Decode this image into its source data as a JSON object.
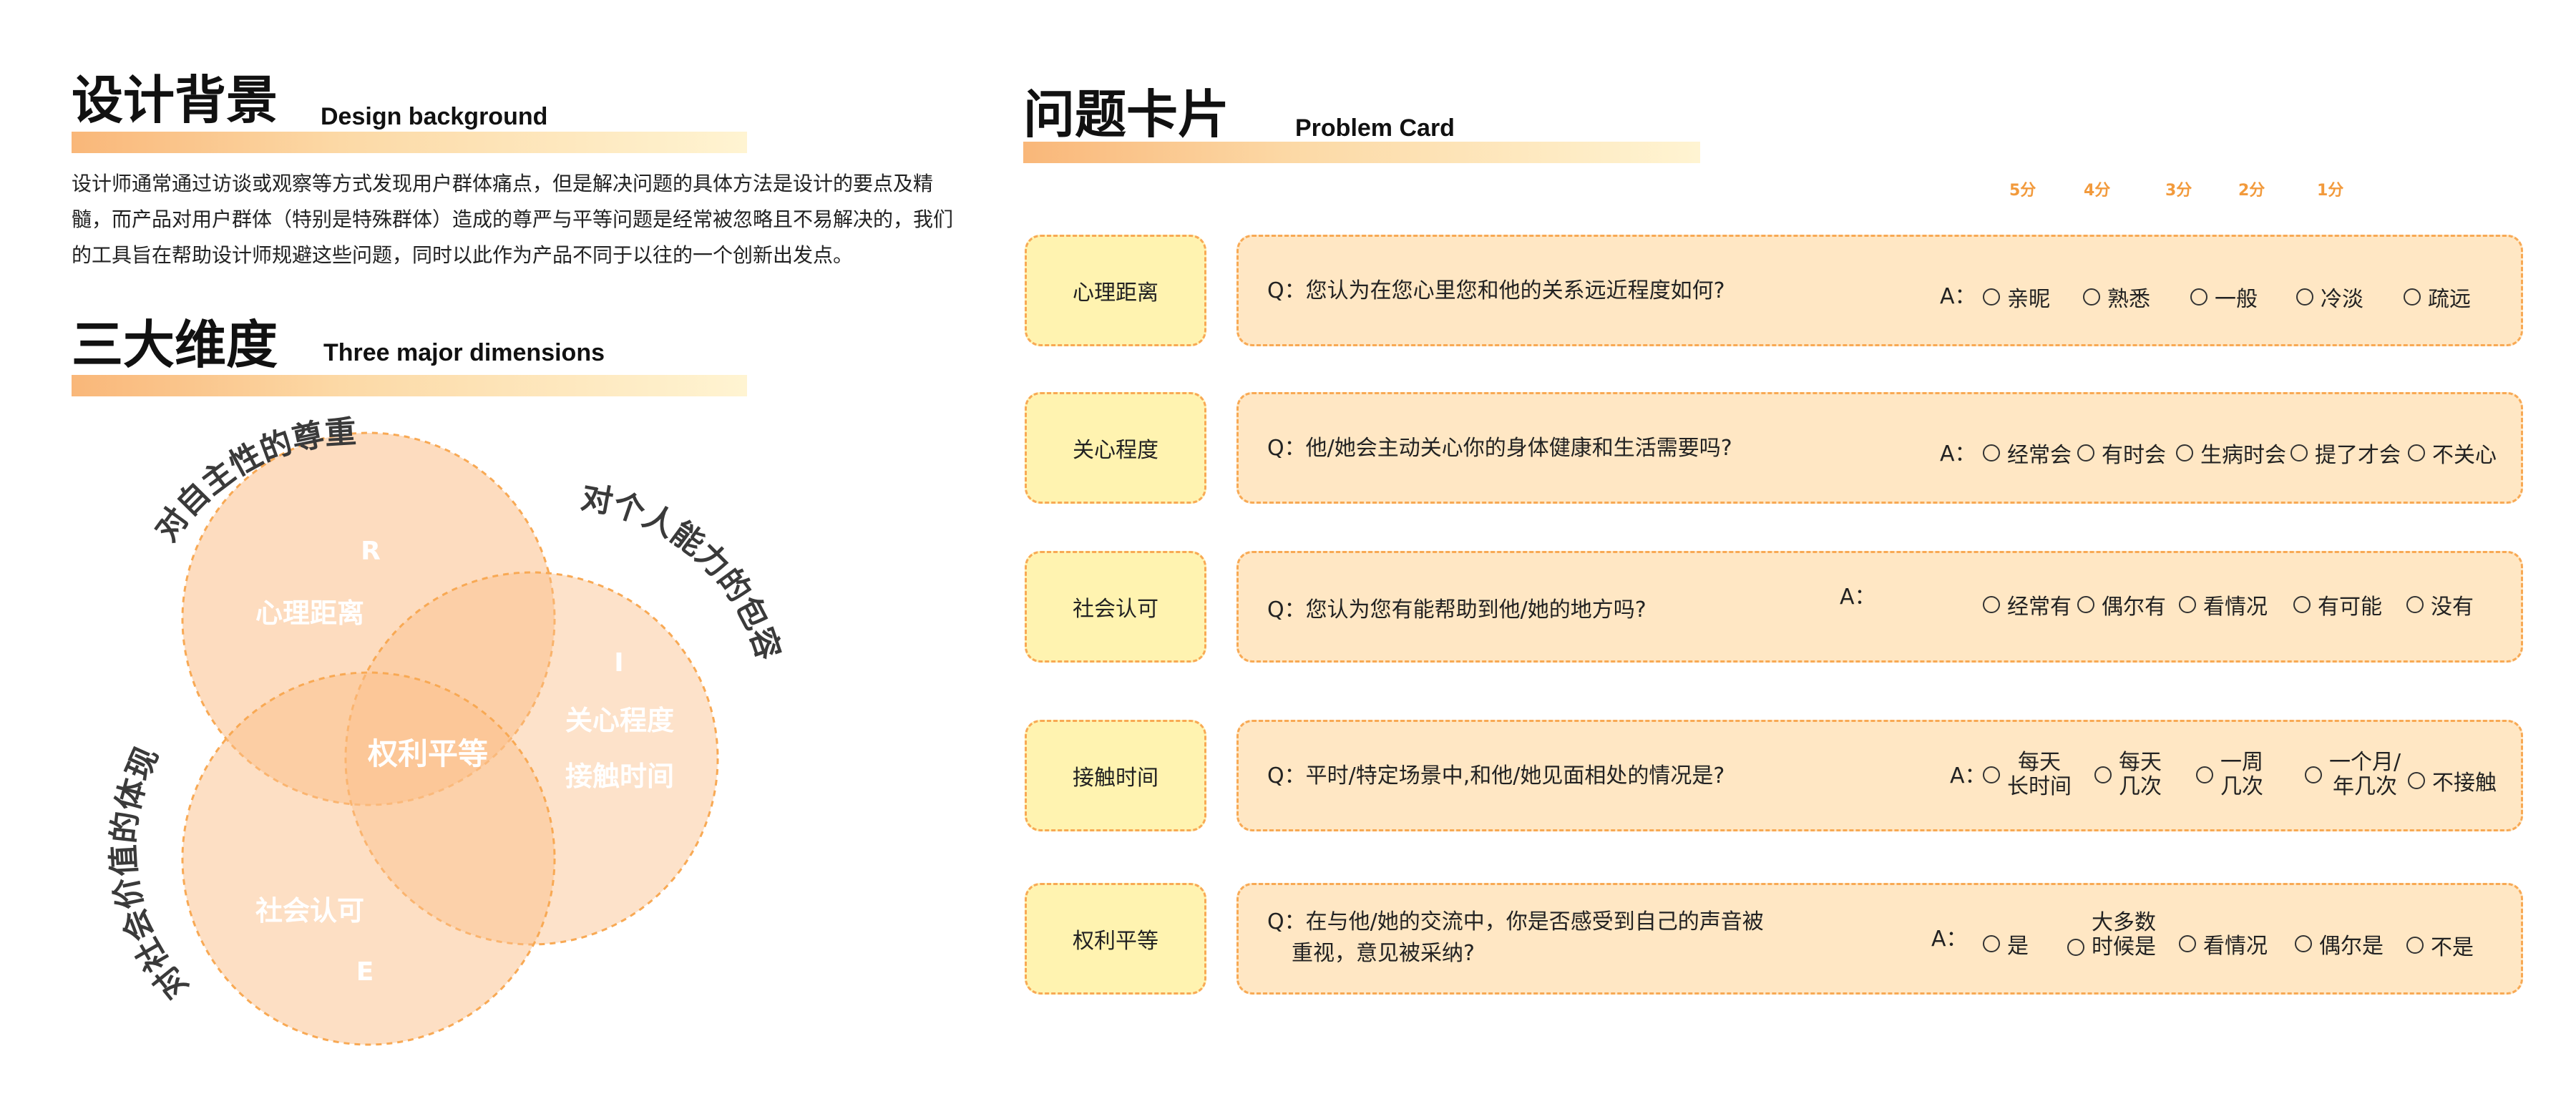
{
  "left": {
    "bg_title": "设计背景",
    "bg_sub": "Design background",
    "bg_text_lines": [
      "设计师通常通过访谈或观察等方式发现用户群体痛点，但是解决问题的具体方法是设计的要点及精",
      "髓，而产品对用户群体（特别是特殊群体）造成的尊严与平等问题是经常被忽略且不易解决的，我们",
      "的工具旨在帮助设计师规避这些问题，同时以此作为产品不同于以往的一个创新出发点。"
    ],
    "dim_title": "三大维度",
    "dim_sub": "Three major dimensions",
    "venn": {
      "arc_top": "对自主性的尊重",
      "arc_right": "对个人能力的包容",
      "arc_left": "对社会价值的体现",
      "letter_r": "R",
      "letter_i": "I",
      "letter_e": "E",
      "label_psych": "心理距离",
      "label_care": "关心程度",
      "label_contact": "接触时间",
      "label_social": "社会认可",
      "label_center": "权利平等"
    }
  },
  "right": {
    "title": "问题卡片",
    "sub": "Problem Card",
    "scores": [
      "5分",
      "4分",
      "3分",
      "2分",
      "1分"
    ],
    "cards": [
      {
        "category": "心理距离",
        "question": "Q：您认为在您心里您和他的关系远近程度如何?",
        "a": "A：",
        "options": [
          "亲昵",
          "熟悉",
          "一般",
          "冷淡",
          "疏远"
        ]
      },
      {
        "category": "关心程度",
        "question": "Q：他/她会主动关心你的身体健康和生活需要吗?",
        "a": "A：",
        "options": [
          "经常会",
          "有时会",
          "生病时会",
          "提了才会",
          "不关心"
        ]
      },
      {
        "category": "社会认可",
        "question": "Q：您认为您有能帮助到他/她的地方吗?",
        "a": "A：",
        "options": [
          "经常有",
          "偶尔有",
          "看情况",
          "有可能",
          "没有"
        ]
      },
      {
        "category": "接触时间",
        "question": "Q：平时/特定场景中,和他/她见面相处的情况是?",
        "a": "A：",
        "options": [
          {
            "l1": "每天",
            "l2": "长时间"
          },
          {
            "l1": "每天",
            "l2": "几次"
          },
          {
            "l1": "一周",
            "l2": "几次"
          },
          {
            "l1": "一个月/",
            "l2": "年几次"
          },
          "不接触"
        ]
      },
      {
        "category": "权利平等",
        "question_l1": "Q：在与他/她的交流中，你是否感受到自己的声音被",
        "question_l2": "重视，意见被采纳?",
        "a": "A：",
        "options": [
          "是",
          {
            "l1": "大多数",
            "l2": "时候是"
          },
          "看情况",
          "偶尔是",
          "不是"
        ]
      }
    ]
  },
  "colors": {
    "accent_orange": "#f8a954",
    "circle_fill": "#fbbf8a",
    "card_bg": "#ffe7c4",
    "category_bg": "#fff3b0",
    "score_text": "#f29a3c"
  }
}
